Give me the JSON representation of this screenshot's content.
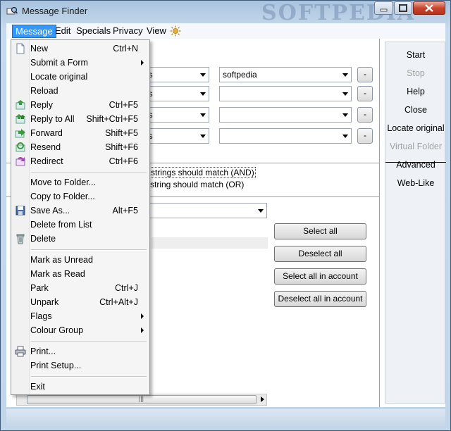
{
  "window": {
    "title": "Message Finder",
    "watermark": "SOFTPEDIA"
  },
  "menubar": {
    "items": [
      "Message",
      "Edit",
      "Specials",
      "Privacy",
      "View"
    ],
    "active": "Message"
  },
  "search": {
    "rows": [
      {
        "field": "ns",
        "value": "softpedia"
      },
      {
        "field": "ns",
        "value": ""
      },
      {
        "field": "ns",
        "value": ""
      },
      {
        "field": "ns",
        "value": ""
      }
    ],
    "minus_label": "-",
    "match_all": "strings should match (AND)",
    "match_any": "string should match (OR)"
  },
  "accounts": {
    "select_all": "Select all",
    "deselect_all": "Deselect all",
    "select_all_in_account": "Select all in account",
    "deselect_all_in_account": "Deselect all in account"
  },
  "sidebar": {
    "buttons": [
      {
        "label": "Start",
        "enabled": true
      },
      {
        "label": "Stop",
        "enabled": false
      },
      {
        "label": "Help",
        "enabled": true
      },
      {
        "label": "Close",
        "enabled": true
      },
      {
        "label": "Locate original",
        "enabled": true
      },
      {
        "label": "Virtual Folder",
        "enabled": false
      },
      {
        "label": "Advanced",
        "enabled": true
      },
      {
        "label": "Web-Like",
        "enabled": true
      }
    ]
  },
  "message_menu": {
    "items": [
      {
        "label": "New",
        "shortcut": "Ctrl+N",
        "icon": "new-document-icon"
      },
      {
        "label": "Submit a Form",
        "shortcut": "",
        "submenu": true
      },
      {
        "label": "Locate original",
        "shortcut": ""
      },
      {
        "label": "Reload",
        "shortcut": ""
      },
      {
        "label": "Reply",
        "shortcut": "Ctrl+F5",
        "icon": "reply-icon"
      },
      {
        "label": "Reply to All",
        "shortcut": "Shift+Ctrl+F5",
        "icon": "reply-all-icon"
      },
      {
        "label": "Forward",
        "shortcut": "Shift+F5",
        "icon": "forward-icon"
      },
      {
        "label": "Resend",
        "shortcut": "Shift+F6",
        "icon": "resend-icon"
      },
      {
        "label": "Redirect",
        "shortcut": "Ctrl+F6",
        "icon": "redirect-icon"
      },
      {
        "label": "Move to Folder...",
        "shortcut": ""
      },
      {
        "label": "Copy to Folder...",
        "shortcut": ""
      },
      {
        "label": "Save As...",
        "shortcut": "Alt+F5",
        "icon": "save-icon"
      },
      {
        "label": "Delete from List",
        "shortcut": ""
      },
      {
        "label": "Delete",
        "shortcut": "",
        "icon": "trash-icon"
      },
      {
        "label": "Mark as Unread",
        "shortcut": ""
      },
      {
        "label": "Mark as Read",
        "shortcut": ""
      },
      {
        "label": "Park",
        "shortcut": "Ctrl+J"
      },
      {
        "label": "Unpark",
        "shortcut": "Ctrl+Alt+J"
      },
      {
        "label": "Flags",
        "shortcut": "",
        "submenu": true
      },
      {
        "label": "Colour Group",
        "shortcut": "",
        "submenu": true
      },
      {
        "label": "Print...",
        "shortcut": "",
        "icon": "printer-icon"
      },
      {
        "label": "Print Setup...",
        "shortcut": ""
      },
      {
        "label": "Exit",
        "shortcut": ""
      }
    ]
  },
  "colors": {
    "menu_highlight": "#3399ff",
    "titlebar": "#c3d5e9"
  }
}
